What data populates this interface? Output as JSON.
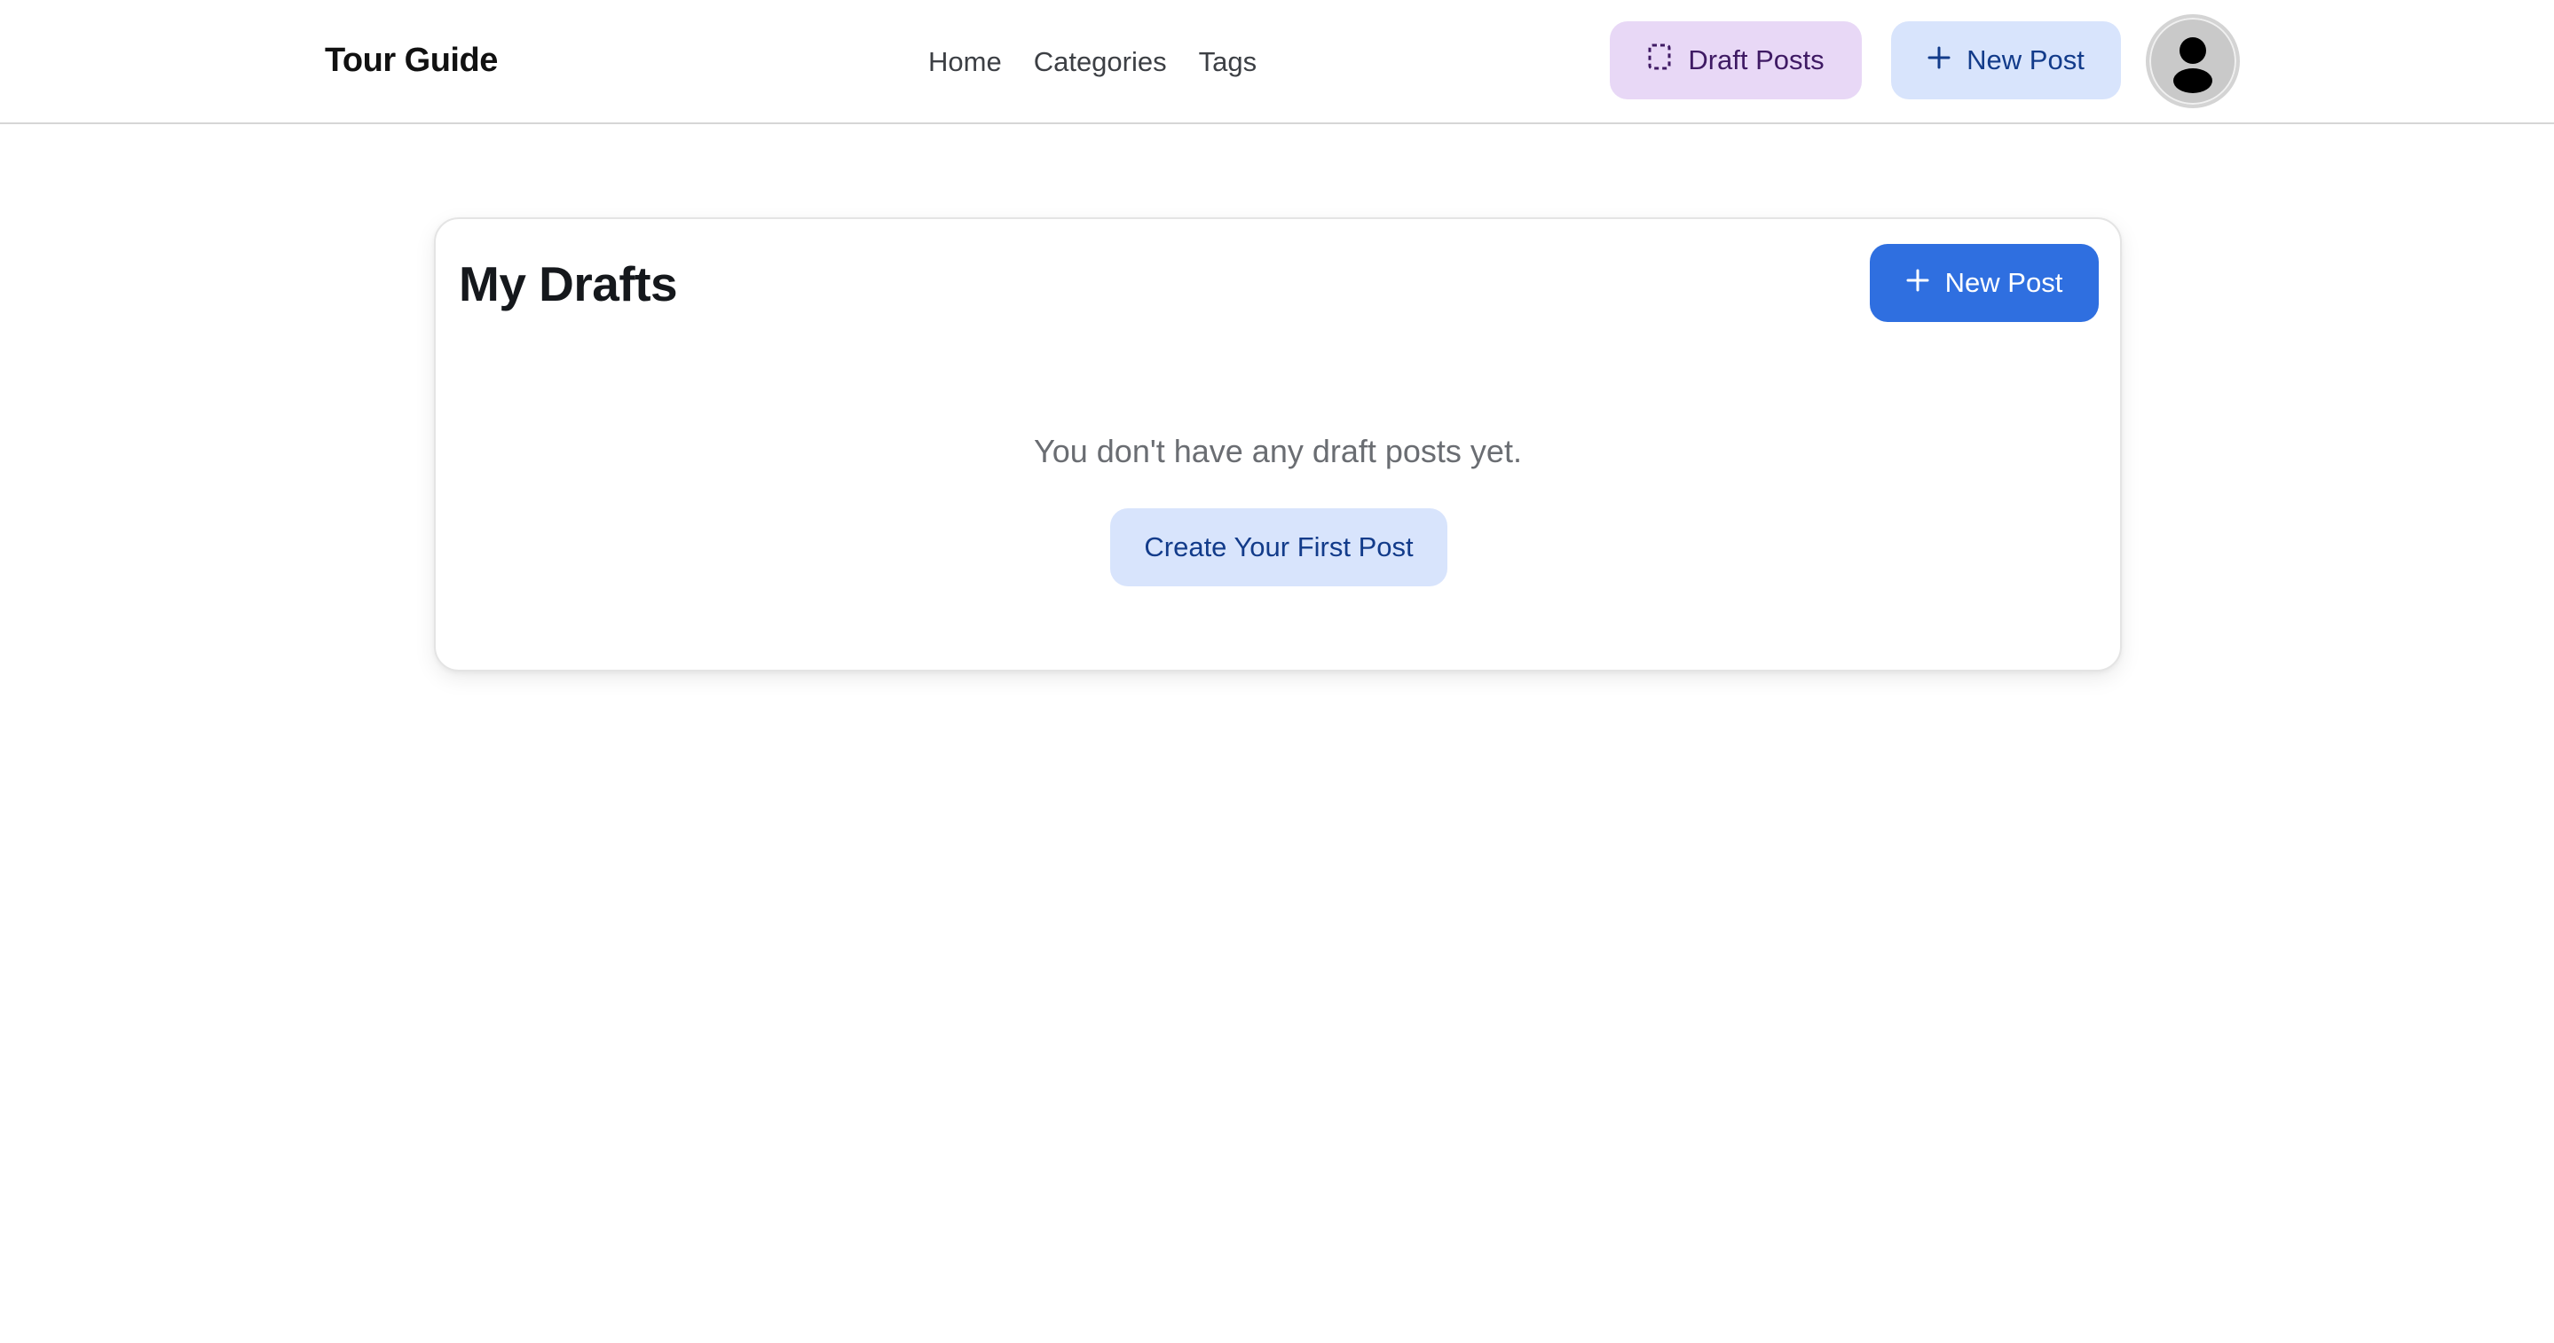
{
  "header": {
    "brand": "Tour Guide",
    "nav": [
      {
        "label": "Home"
      },
      {
        "label": "Categories"
      },
      {
        "label": "Tags"
      }
    ],
    "drafts_button": {
      "label": "Draft Posts",
      "icon": "dashed-square-icon"
    },
    "new_post_button": {
      "label": "New Post",
      "icon": "plus-icon"
    },
    "avatar": {
      "icon": "user-icon"
    }
  },
  "main": {
    "title": "My Drafts",
    "new_post_button": {
      "label": "New Post",
      "icon": "plus-icon"
    },
    "empty_message": "You don't have any draft posts yet.",
    "create_button": {
      "label": "Create Your First Post"
    }
  },
  "colors": {
    "primary": "#2f6fe0",
    "primary_soft": "#d8e4fc",
    "drafts_soft": "#e8d8f6",
    "text_muted": "#6a6d72"
  }
}
